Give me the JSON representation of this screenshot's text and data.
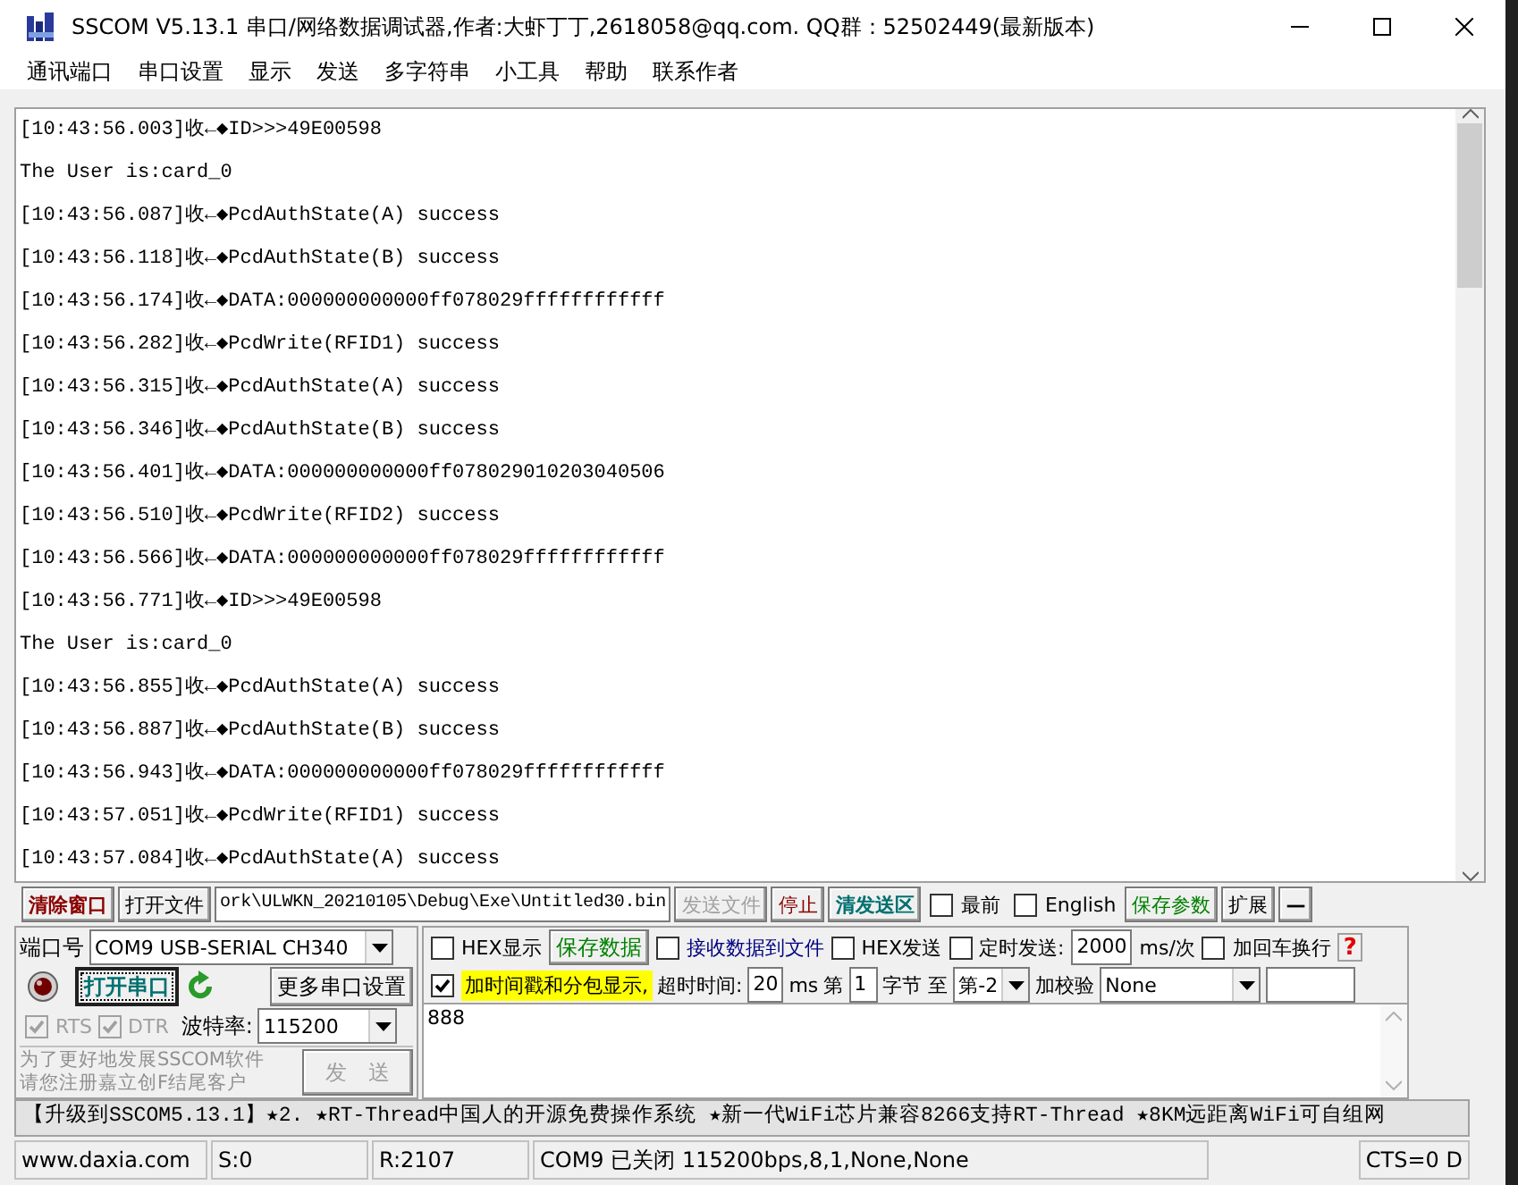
{
  "window": {
    "title": "SSCOM V5.13.1 串口/网络数据调试器,作者:大虾丁丁,2618058@qq.com. QQ群：52502449(最新版本)"
  },
  "menu": [
    "通讯端口",
    "串口设置",
    "显示",
    "发送",
    "多字符串",
    "小工具",
    "帮助",
    "联系作者"
  ],
  "log": [
    "[10:43:56.003]收←◆ID>>>49E00598",
    "The User is:card_0",
    "[10:43:56.087]收←◆PcdAuthState(A) success",
    "[10:43:56.118]收←◆PcdAuthState(B) success",
    "[10:43:56.174]收←◆DATA:000000000000ff078029ffffffffffff",
    "[10:43:56.282]收←◆PcdWrite(RFID1) success",
    "[10:43:56.315]收←◆PcdAuthState(A) success",
    "[10:43:56.346]收←◆PcdAuthState(B) success",
    "[10:43:56.401]收←◆DATA:000000000000ff078029010203040506",
    "[10:43:56.510]收←◆PcdWrite(RFID2) success",
    "[10:43:56.566]收←◆DATA:000000000000ff078029ffffffffffff",
    "[10:43:56.771]收←◆ID>>>49E00598",
    "The User is:card_0",
    "[10:43:56.855]收←◆PcdAuthState(A) success",
    "[10:43:56.887]收←◆PcdAuthState(B) success",
    "[10:43:56.943]收←◆DATA:000000000000ff078029ffffffffffff",
    "[10:43:57.051]收←◆PcdWrite(RFID1) success",
    "[10:43:57.084]收←◆PcdAuthState(A) success"
  ],
  "toolbar": [
    {
      "kind": "button",
      "label": "清除窗口",
      "color": "#8b0000"
    },
    {
      "kind": "button",
      "label": "打开文件",
      "color": "#000000"
    },
    {
      "kind": "field",
      "value": "ork\\ULWKN_20210105\\Debug\\Exe\\Untitled30.bin"
    },
    {
      "kind": "button",
      "label": "发送文件",
      "disabled": true
    },
    {
      "kind": "button",
      "label": "停止",
      "color": "#8b0000"
    },
    {
      "kind": "button",
      "label": "清发送区",
      "color": "#007070"
    },
    {
      "kind": "checkbox",
      "label": "最前",
      "checked": false
    },
    {
      "kind": "checkbox",
      "label": "English",
      "checked": false
    },
    {
      "kind": "button",
      "label": "保存参数",
      "color": "#008000"
    },
    {
      "kind": "button",
      "label": "扩展",
      "color": "#000000"
    },
    {
      "kind": "button",
      "label": "—",
      "color": "#000000"
    }
  ],
  "port": {
    "label": "端口号",
    "value": "COM9 USB-SERIAL CH340",
    "open": false,
    "open_button": "打开串口",
    "more_button": "更多串口设置",
    "rts": {
      "label": "RTS",
      "checked": true,
      "disabled": true
    },
    "dtr": {
      "label": "DTR",
      "checked": true,
      "disabled": true
    },
    "baud_label": "波特率:",
    "baud": "115200",
    "promo": [
      "为了更好地发展SSCOM软件",
      "请您注册嘉立创F结尾客户"
    ],
    "send_button": {
      "label": "发　送",
      "disabled": true
    }
  },
  "options_row1": [
    {
      "kind": "checkbox",
      "label": "HEX显示",
      "checked": false
    },
    {
      "kind": "button",
      "label": "保存数据",
      "color": "#008000"
    },
    {
      "kind": "checkbox",
      "label": "接收数据到文件",
      "checked": false,
      "color": "#000080"
    },
    {
      "kind": "checkbox",
      "label": "HEX发送",
      "checked": false
    },
    {
      "kind": "checkbox",
      "label": "定时发送:",
      "checked": false
    },
    {
      "kind": "field",
      "value": "2000"
    },
    {
      "kind": "text",
      "label": "ms/次"
    },
    {
      "kind": "checkbox",
      "label": "加回车换行",
      "checked": false
    },
    {
      "kind": "help",
      "label": "?"
    }
  ],
  "options_row2": [
    {
      "kind": "checkbox",
      "label": "加时间戳和分包显示,",
      "checked": true,
      "highlight": true
    },
    {
      "kind": "text",
      "label": "超时时间:"
    },
    {
      "kind": "field",
      "value": "20"
    },
    {
      "kind": "text",
      "label": "ms"
    },
    {
      "kind": "text",
      "label": "第"
    },
    {
      "kind": "field",
      "value": "1"
    },
    {
      "kind": "text",
      "label": "字节 至"
    },
    {
      "kind": "select",
      "value": "第-2"
    },
    {
      "kind": "text",
      "label": "加校验"
    },
    {
      "kind": "select",
      "value": "None"
    },
    {
      "kind": "field"
    }
  ],
  "send_text": "888",
  "ticker": "【升级到SSCOM5.13.1】★2. ★RT-Thread中国人的开源免费操作系统 ★新一代WiFi芯片兼容8266支持RT-Thread ★8KM远距离WiFi可自组网",
  "status_bar": [
    "www.daxia.com",
    "S:0",
    "R:2107",
    "COM9 已关闭  115200bps,8,1,None,None",
    "CTS=0 D"
  ]
}
